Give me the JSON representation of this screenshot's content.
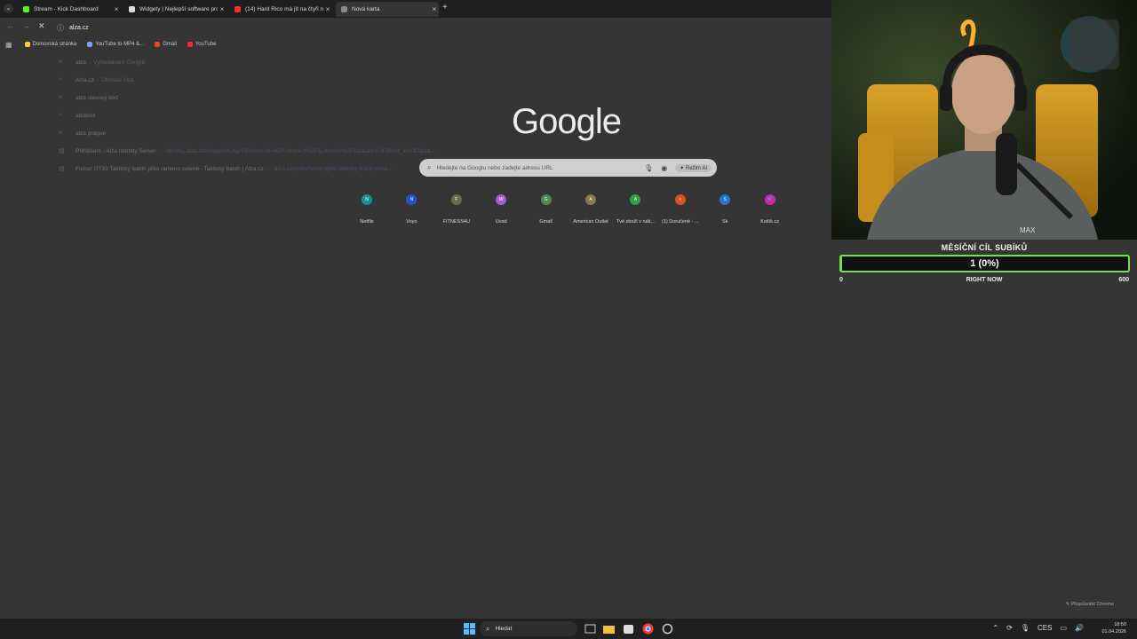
{
  "browser": {
    "tabs": [
      {
        "title": "Stream - Kick Dashboard",
        "favicon_color": "#53fc18"
      },
      {
        "title": "Widgety | Nejlepší software pro...",
        "favicon_color": "#dddddd"
      },
      {
        "title": "(14) Hard Rico má jít na čtyři n...",
        "favicon_color": "#ff2b2b"
      },
      {
        "title": "Nová karta",
        "favicon_color": "#888888"
      }
    ],
    "omnibox_value": "alza.cz",
    "bookmarks": [
      {
        "label": "Domovská stránka",
        "color": "#ffcc33"
      },
      {
        "label": "YouTube to MP4 &...",
        "color": "#7aa2ff"
      },
      {
        "label": "Gmail",
        "color": "#ea4335"
      },
      {
        "label": "YouTube",
        "color": "#ff2b2b"
      }
    ],
    "suggestions": [
      {
        "icon": "search-icon",
        "text": "alza",
        "extra": "- Vyhledávání Google",
        "url": ""
      },
      {
        "icon": "search-icon",
        "text": "Alza.cz",
        "extra": "- Obchod Alza",
        "url": ""
      },
      {
        "icon": "search-icon",
        "text": "alza slevový kód",
        "extra": "",
        "url": ""
      },
      {
        "icon": "search-icon",
        "text": "alzabox",
        "extra": "",
        "url": ""
      },
      {
        "icon": "search-icon",
        "text": "alza prague",
        "extra": "",
        "url": ""
      },
      {
        "icon": "history-icon",
        "text": "Přihlášení - Alza Identity Server",
        "extra": "-",
        "url": "identity.alza.cz/Account/Login?ReturnUrl=%2Fconnect%2Fauthorize%2Fcallback%3Fclient_id%3Dalza..."
      },
      {
        "icon": "history-icon",
        "text": "Forcer GT93 Taktický batoh přes rameno celené - Taktický batoh | Alza.cz",
        "extra": "-",
        "url": "alza.cz/sport/forcer-gt93-takticky-batoh-pres..."
      }
    ]
  },
  "newtab": {
    "logo_text": "Google",
    "search_placeholder": "Hledejte na Googlu nebo zadejte adresu URL",
    "ai_mode_label": "Režim AI",
    "shortcuts": [
      {
        "label": "Netflix",
        "letter": "N",
        "color": "#1a8f8f"
      },
      {
        "label": "Voyo",
        "letter": "N",
        "color": "#2b4fd6"
      },
      {
        "label": "FITNESS4U",
        "letter": "F",
        "color": "#6b6b4a"
      },
      {
        "label": "Úvod",
        "letter": "W",
        "color": "#a35cd6"
      },
      {
        "label": "Gmail",
        "letter": "G",
        "color": "#4a8a5a"
      },
      {
        "label": "American Outlet",
        "letter": "A",
        "color": "#8a7a4a"
      },
      {
        "label": "Tvé zboží v nák...",
        "letter": "A",
        "color": "#2f9e44"
      },
      {
        "label": "(1) Doručené - ...",
        "letter": "<",
        "color": "#d9531e"
      },
      {
        "label": "Sk",
        "letter": "S",
        "color": "#2b6fd6"
      },
      {
        "label": "Košík.cz",
        "letter": "🛒",
        "color": "#c42bb0"
      }
    ],
    "customize_label": "Přizpůsobit Chrome"
  },
  "overlay": {
    "goal_title": "MĚSÍČNÍ CÍL SUBÍKŮ",
    "goal_value": "1 (0%)",
    "goal_progress_fraction": 0.0017,
    "goal_min": "0",
    "goal_label": "RIGHT NOW",
    "goal_max": "600",
    "accent": "#6fe34a"
  },
  "taskbar": {
    "search_label": "Hledat",
    "language": "CES",
    "time": "18:50",
    "date": "01.04.2026"
  }
}
